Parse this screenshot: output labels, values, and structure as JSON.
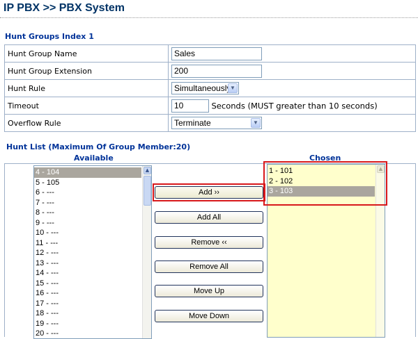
{
  "header": {
    "title": "IP PBX >> PBX System"
  },
  "section": {
    "title": "Hunt Groups Index 1"
  },
  "form": {
    "name_label": "Hunt Group Name",
    "name_value": "Sales",
    "ext_label": "Hunt Group Extension",
    "ext_value": "200",
    "rule_label": "Hunt Rule",
    "rule_value": "Simultaneously",
    "timeout_label": "Timeout",
    "timeout_value": "10",
    "timeout_note": "Seconds (MUST greater than 10 seconds)",
    "overflow_label": "Overflow Rule",
    "overflow_value": "Terminate"
  },
  "hunt_list": {
    "title": "Hunt List (Maximum Of Group Member:20)",
    "available_label": "Available",
    "chosen_label": "Chosen",
    "available": [
      "4 - 104",
      "5 - 105",
      "6 - ---",
      "7 - ---",
      "8 - ---",
      "9 - ---",
      "10 - ---",
      "11 - ---",
      "12 - ---",
      "13 - ---",
      "14 - ---",
      "15 - ---",
      "16 - ---",
      "17 - ---",
      "18 - ---",
      "19 - ---",
      "20 - ---"
    ],
    "available_selected_index": 0,
    "chosen": [
      "1 - 101",
      "2 - 102",
      "3 - 103"
    ],
    "chosen_selected_index": 2
  },
  "buttons": {
    "add": "Add ››",
    "add_all": "Add All",
    "remove": "Remove ‹‹",
    "remove_all": "Remove All",
    "move_up": "Move Up",
    "move_down": "Move Down"
  },
  "colors": {
    "highlight": "#d8181a",
    "heading": "#003399",
    "chosen_bg": "#ffffcc"
  }
}
